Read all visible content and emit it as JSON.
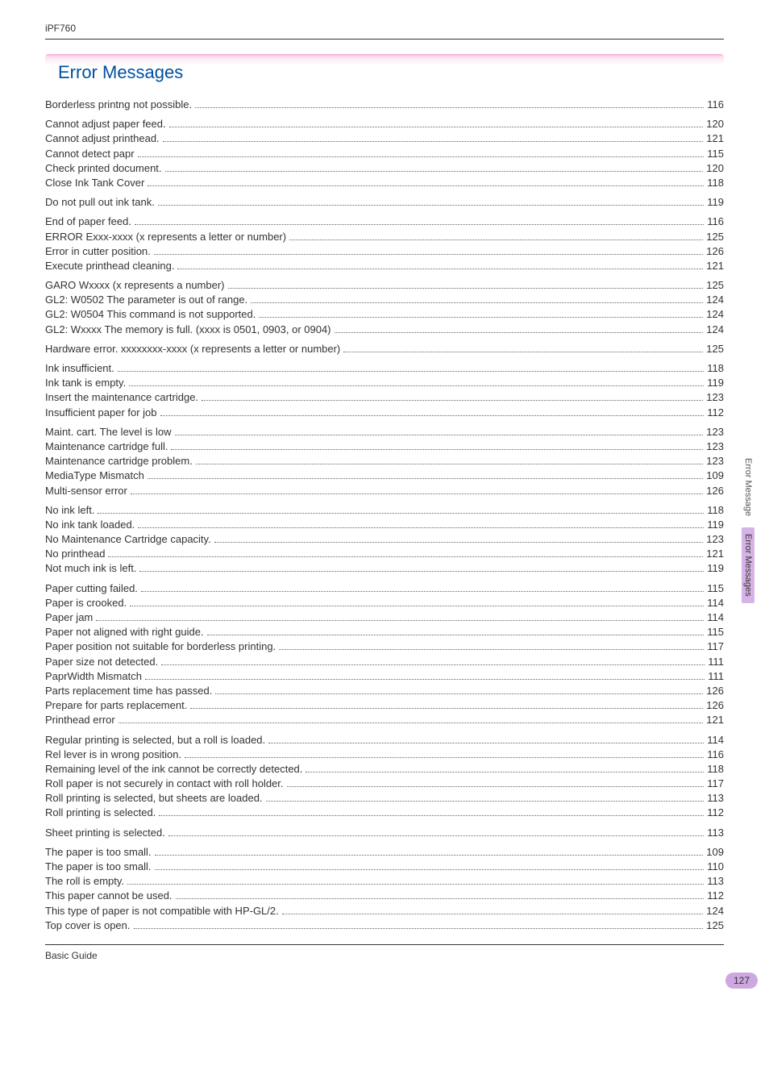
{
  "header": {
    "model": "iPF760"
  },
  "title": "Error Messages",
  "side": {
    "top": "Error Message",
    "active": "Error Messages"
  },
  "pageNumber": "127",
  "footer": "Basic Guide",
  "groups": [
    [
      {
        "label": "Borderless printng not possible.",
        "page": "116"
      }
    ],
    [
      {
        "label": "Cannot adjust paper feed.",
        "page": "120"
      },
      {
        "label": "Cannot adjust printhead.",
        "page": "121"
      },
      {
        "label": "Cannot detect papr",
        "page": "115"
      },
      {
        "label": "Check printed document.",
        "page": "120"
      },
      {
        "label": "Close Ink Tank Cover",
        "page": "118"
      }
    ],
    [
      {
        "label": "Do not pull out ink tank.",
        "page": "119"
      }
    ],
    [
      {
        "label": "End of paper feed.",
        "page": "116"
      },
      {
        "label": "ERROR Exxx-xxxx (x represents a letter or number)",
        "page": "125"
      },
      {
        "label": "Error in cutter position.",
        "page": "126"
      },
      {
        "label": "Execute printhead cleaning.",
        "page": "121"
      }
    ],
    [
      {
        "label": "GARO Wxxxx (x represents a number)",
        "page": "125"
      },
      {
        "label": "GL2: W0502 The parameter is out of range.",
        "page": "124"
      },
      {
        "label": "GL2: W0504 This command is not supported.",
        "page": "124"
      },
      {
        "label": "GL2: Wxxxx The memory is full. (xxxx is 0501, 0903, or 0904)",
        "page": "124"
      }
    ],
    [
      {
        "label": "Hardware error. xxxxxxxx-xxxx (x represents a letter or number)",
        "page": "125"
      }
    ],
    [
      {
        "label": "Ink insufficient.",
        "page": "118"
      },
      {
        "label": "Ink tank is empty.",
        "page": "119"
      },
      {
        "label": "Insert the maintenance cartridge.",
        "page": "123"
      },
      {
        "label": "Insufficient paper for job",
        "page": "112"
      }
    ],
    [
      {
        "label": "Maint. cart. The level is low",
        "page": "123"
      },
      {
        "label": "Maintenance cartridge full.",
        "page": "123"
      },
      {
        "label": "Maintenance cartridge problem.",
        "page": "123"
      },
      {
        "label": "MediaType Mismatch",
        "page": "109"
      },
      {
        "label": "Multi-sensor error",
        "page": "126"
      }
    ],
    [
      {
        "label": "No ink left.",
        "page": "118"
      },
      {
        "label": "No ink tank loaded.",
        "page": "119"
      },
      {
        "label": "No Maintenance Cartridge capacity.",
        "page": "123"
      },
      {
        "label": "No printhead",
        "page": "121"
      },
      {
        "label": "Not much ink is left.",
        "page": "119"
      }
    ],
    [
      {
        "label": "Paper cutting failed.",
        "page": "115"
      },
      {
        "label": "Paper is crooked.",
        "page": "114"
      },
      {
        "label": "Paper jam",
        "page": "114"
      },
      {
        "label": "Paper not aligned with right guide.",
        "page": "115"
      },
      {
        "label": "Paper position not suitable for borderless printing.",
        "page": "117"
      },
      {
        "label": "Paper size not detected.",
        "page": "111"
      },
      {
        "label": "PaprWidth Mismatch",
        "page": "111"
      },
      {
        "label": "Parts replacement time has passed.",
        "page": "126"
      },
      {
        "label": "Prepare for parts replacement.",
        "page": "126"
      },
      {
        "label": "Printhead error",
        "page": "121"
      }
    ],
    [
      {
        "label": "Regular printing is selected, but a roll is loaded.",
        "page": "114"
      },
      {
        "label": "Rel lever is in wrong position.",
        "page": "116"
      },
      {
        "label": "Remaining level of the ink cannot be correctly detected.",
        "page": "118"
      },
      {
        "label": "Roll paper is not securely in contact with roll holder.",
        "page": "117"
      },
      {
        "label": "Roll printing is selected, but sheets are loaded.",
        "page": "113"
      },
      {
        "label": "Roll printing is selected.",
        "page": "112"
      }
    ],
    [
      {
        "label": "Sheet printing is selected.",
        "page": "113"
      }
    ],
    [
      {
        "label": "The paper is too small.",
        "page": "109"
      },
      {
        "label": "The paper is too small.",
        "page": "110"
      },
      {
        "label": "The roll is empty.",
        "page": "113"
      },
      {
        "label": "This paper cannot be used.",
        "page": "112"
      },
      {
        "label": "This type of paper is not compatible with HP-GL/2.",
        "page": "124"
      },
      {
        "label": "Top cover is open.",
        "page": "125"
      }
    ]
  ]
}
